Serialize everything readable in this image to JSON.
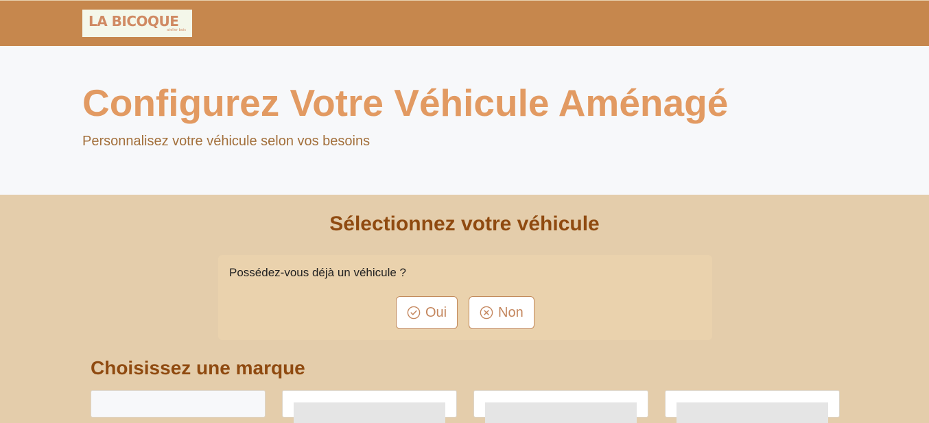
{
  "header": {
    "logo_text": "LA BICOQUE",
    "logo_subtext": "atelier bois"
  },
  "hero": {
    "title": "Configurez Votre Véhicule Aménagé",
    "subtitle": "Personnalisez votre véhicule selon vos besoins"
  },
  "main": {
    "section_title": "Sélectionnez votre véhicule",
    "question": {
      "text": "Possédez-vous déjà un véhicule ?",
      "yes_label": "Oui",
      "yes_icon": "check-circle-icon",
      "no_label": "Non",
      "no_icon": "x-circle-icon"
    },
    "brands_title": "Choisissez une marque"
  },
  "colors": {
    "header_bg": "#c6874d",
    "hero_bg": "#f7f8fa",
    "title_accent": "#e29a62",
    "subtitle": "#a3703c",
    "main_bg": "#e4cdab",
    "card_bg": "#ead2ad",
    "section_heading": "#8f4a10",
    "button_text": "#c4865d"
  }
}
